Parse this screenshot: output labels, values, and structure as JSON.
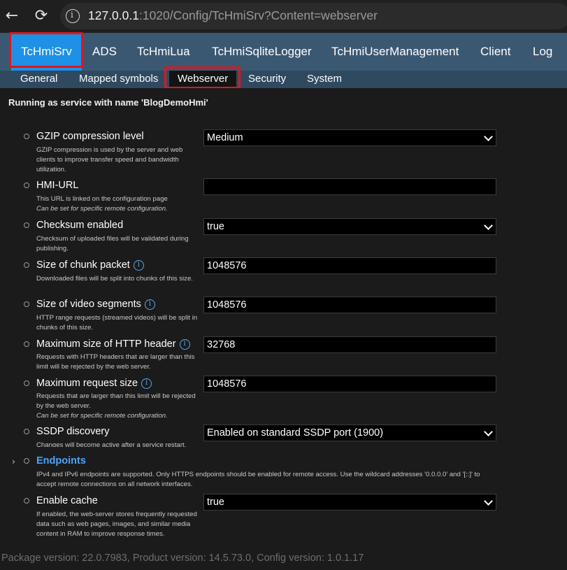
{
  "browser": {
    "url_host": "127.0.0.1",
    "url_rest": ":1020/Config/TcHmiSrv?Content=webserver"
  },
  "main_tabs": [
    "TcHmiSrv",
    "ADS",
    "TcHmiLua",
    "TcHmiSqliteLogger",
    "TcHmiUserManagement",
    "Client",
    "Log"
  ],
  "sub_tabs": [
    "General",
    "Mapped symbols",
    "Webserver",
    "Security",
    "System"
  ],
  "service_title": "Running as service with name 'BlogDemoHmi'",
  "settings": [
    {
      "label": "GZIP compression level",
      "desc": "GZIP compression is used by the server and web clients to improve transfer speed and bandwidth utilization.",
      "note": "",
      "value": "Medium",
      "info": false
    },
    {
      "label": "HMI-URL",
      "desc": "This URL is linked on the configuration page",
      "note": "Can be set for specific remote configuration.",
      "value": "",
      "info": false
    },
    {
      "label": "Checksum enabled",
      "desc": "Checksum of uploaded files will be validated during publishing.",
      "note": "",
      "value": "true",
      "info": false
    },
    {
      "label": "Size of chunk packet",
      "desc": "Downloaded files will be split into chunks of this size.",
      "note": "",
      "value": "1048576",
      "info": true
    },
    {
      "label": "Size of video segments",
      "desc": "HTTP range requests (streamed videos) will be split in chunks of this size.",
      "note": "",
      "value": "1048576",
      "info": true
    },
    {
      "label": "Maximum size of HTTP header",
      "desc": "Requests with HTTP headers that are larger than this limit will be rejected by the web server.",
      "note": "",
      "value": "32768",
      "info": true
    },
    {
      "label": "Maximum request size",
      "desc": "Requests that are larger than this limit will be rejected by the web server.",
      "note": "Can be set for specific remote configuration.",
      "value": "1048576",
      "info": true
    },
    {
      "label": "SSDP discovery",
      "desc": "Changes will become active after a service restart.",
      "note": "",
      "value": "Enabled on standard SSDP port (1900)",
      "info": false
    },
    {
      "label": "Endpoints",
      "desc": "IPv4 and IPv6 endpoints are supported. Only HTTPS endpoints should be enabled for remote access. Use the wildcard addresses '0.0.0.0' and '[::]' to accept remote connections on all network interfaces.",
      "note": "",
      "value": "",
      "info": false
    },
    {
      "label": "Enable cache",
      "desc": "If enabled, the web-server stores frequently requested data such as web pages, images, and similar media content in RAM to improve response times.",
      "note": "",
      "value": "true",
      "info": false
    }
  ],
  "footer": "Package version: 22.0.7983, Product version: 14.5.73.0, Config version: 1.0.1.17",
  "colors": {
    "accent": "#1e90e6",
    "highlight": "#e0161b",
    "link": "#4da3ff"
  }
}
